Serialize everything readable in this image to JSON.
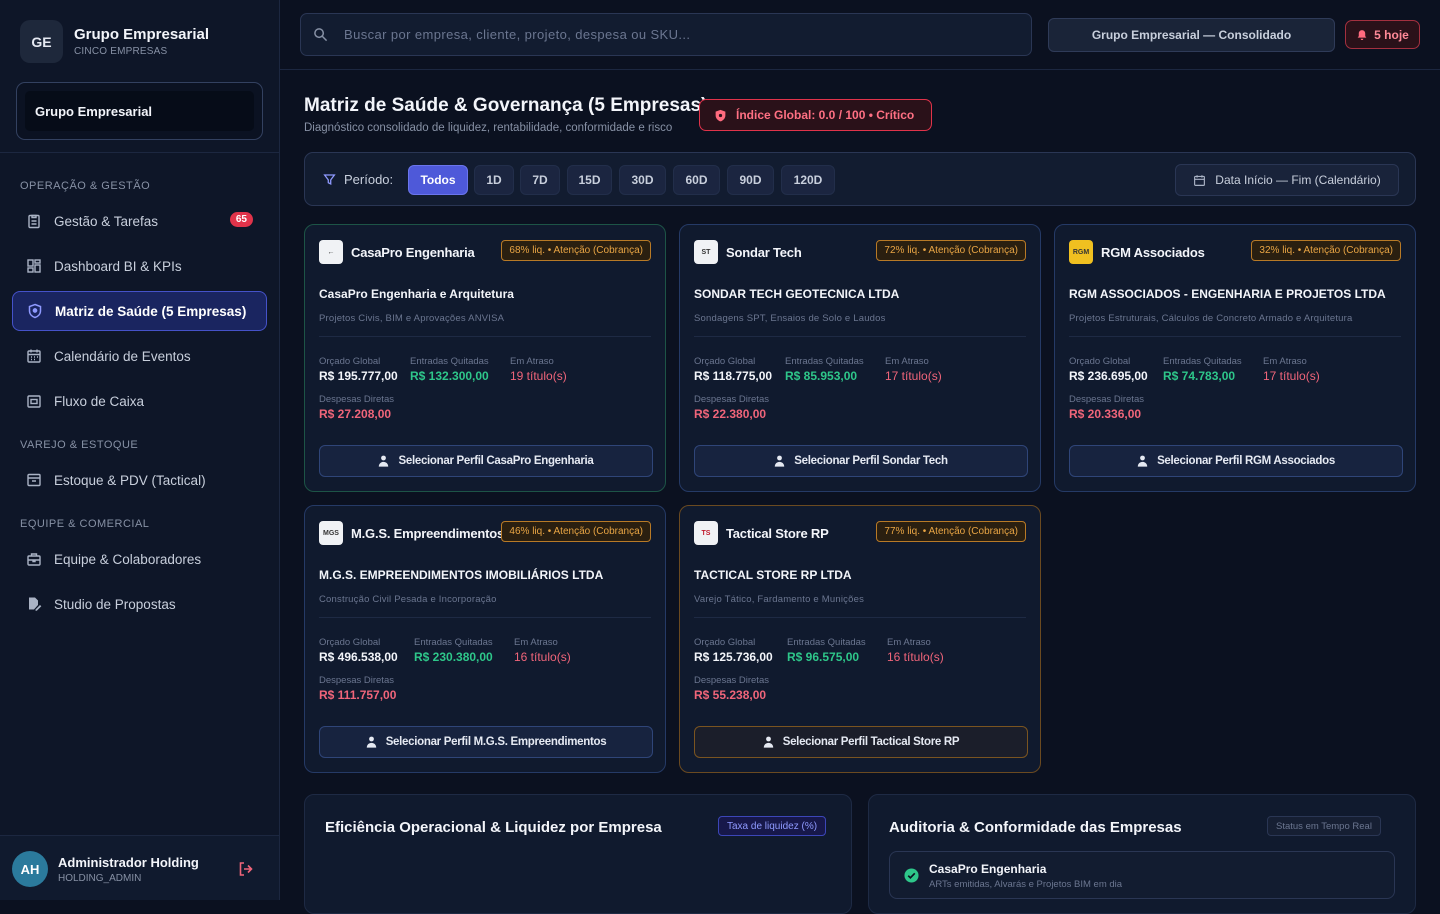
{
  "brand": {
    "initials": "GE",
    "title": "Grupo Empresarial",
    "subtitle": "CINCO EMPRESAS"
  },
  "company_selector": {
    "value": "Grupo Empresarial"
  },
  "nav": {
    "sections": [
      {
        "label": "OPERAÇÃO & GESTÃO"
      },
      {
        "label": "VAREJO & ESTOQUE"
      },
      {
        "label": "EQUIPE & COMERCIAL"
      }
    ],
    "items": [
      {
        "label": "Gestão & Tarefas",
        "badge": "65",
        "icon": "clipboard-icon"
      },
      {
        "label": "Dashboard BI & KPIs",
        "icon": "dashboard-icon"
      },
      {
        "label": "Matriz de Saúde (5 Empresas)",
        "icon": "shield-icon"
      },
      {
        "label": "Calendário de Eventos",
        "icon": "calendar-icon"
      },
      {
        "label": "Fluxo de Caixa",
        "icon": "wallet-icon"
      },
      {
        "label": "Estoque & PDV (Tactical)",
        "icon": "box-icon"
      },
      {
        "label": "Equipe & Colaboradores",
        "icon": "briefcase-icon"
      },
      {
        "label": "Studio de Propostas",
        "icon": "document-edit-icon"
      }
    ]
  },
  "user": {
    "initials": "AH",
    "name": "Administrador Holding",
    "role": "HOLDING_ADMIN"
  },
  "topbar": {
    "search_placeholder": "Buscar por empresa, cliente, projeto, despesa ou SKU...",
    "consolidated_label": "Grupo Empresarial — Consolidado",
    "notifications_label": "5 hoje"
  },
  "page": {
    "title": "Matriz de Saúde & Governança (5 Empresas)",
    "subtitle": "Diagnóstico consolidado de liquidez, rentabilidade, conformidade e risco",
    "index_badge": "Índice Global: 0.0 / 100 • Crítico"
  },
  "filters": {
    "label": "Período:",
    "periods": [
      "Todos",
      "1D",
      "7D",
      "15D",
      "30D",
      "60D",
      "90D",
      "120D"
    ],
    "active": "Todos",
    "date_range": "Data Início — Fim (Calendário)"
  },
  "metric_labels": {
    "budget": "Orçado Global",
    "paid": "Entradas Quitadas",
    "overdue": "Em Atraso",
    "expenses": "Despesas Diretas"
  },
  "companies": [
    {
      "name": "CasaPro Engenharia",
      "logo": "←",
      "badge": "68% liq. • Atenção (Cobrança)",
      "legal": "CasaPro Engenharia e Arquitetura",
      "desc": "Projetos Civis, BIM e Aprovações ANVISA",
      "budget": "R$ 195.777,00",
      "paid": "R$ 132.300,00",
      "overdue": "19 título(s)",
      "expenses": "R$ 27.208,00",
      "button": "Selecionar Perfil CasaPro Engenharia"
    },
    {
      "name": "Sondar Tech",
      "logo": "ST",
      "badge": "72% liq. • Atenção (Cobrança)",
      "legal": "SONDAR TECH GEOTECNICA LTDA",
      "desc": "Sondagens SPT, Ensaios de Solo e Laudos",
      "budget": "R$ 118.775,00",
      "paid": "R$ 85.953,00",
      "overdue": "17 título(s)",
      "expenses": "R$ 22.380,00",
      "button": "Selecionar Perfil Sondar Tech"
    },
    {
      "name": "RGM Associados",
      "logo": "RGM",
      "badge": "32% liq. • Atenção (Cobrança)",
      "legal": "RGM ASSOCIADOS - ENGENHARIA E PROJETOS LTDA",
      "desc": "Projetos Estruturais, Cálculos de Concreto Armado e Arquitetura",
      "budget": "R$ 236.695,00",
      "paid": "R$ 74.783,00",
      "overdue": "17 título(s)",
      "expenses": "R$ 20.336,00",
      "button": "Selecionar Perfil RGM Associados"
    },
    {
      "name": "M.G.S. Empreendimentos",
      "logo": "MGS",
      "badge": "46% liq. • Atenção (Cobrança)",
      "legal": "M.G.S. EMPREENDIMENTOS IMOBILIÁRIOS LTDA",
      "desc": "Construção Civil Pesada e Incorporação",
      "budget": "R$ 496.538,00",
      "paid": "R$ 230.380,00",
      "overdue": "16 título(s)",
      "expenses": "R$ 111.757,00",
      "button": "Selecionar Perfil M.G.S. Empreendimentos"
    },
    {
      "name": "Tactical Store RP",
      "logo": "TS",
      "badge": "77% liq. • Atenção (Cobrança)",
      "legal": "TACTICAL STORE RP LTDA",
      "desc": "Varejo Tático, Fardamento e Munições",
      "budget": "R$ 125.736,00",
      "paid": "R$ 96.575,00",
      "overdue": "16 título(s)",
      "expenses": "R$ 55.238,00",
      "button": "Selecionar Perfil Tactical Store RP"
    }
  ],
  "efficiency_panel": {
    "title": "Eficiência Operacional & Liquidez por Empresa",
    "pill": "Taxa de liquidez (%)"
  },
  "audit_panel": {
    "title": "Auditoria & Conformidade das Empresas",
    "pill": "Status em Tempo Real",
    "items": [
      {
        "name": "CasaPro Engenharia",
        "desc": "ARTs emitidas, Alvarás e Projetos BIM em dia"
      }
    ]
  },
  "colors": {
    "accent": "#4e59d9",
    "danger": "#e0334a",
    "success": "#2ec78a",
    "warning": "#e9a544"
  }
}
